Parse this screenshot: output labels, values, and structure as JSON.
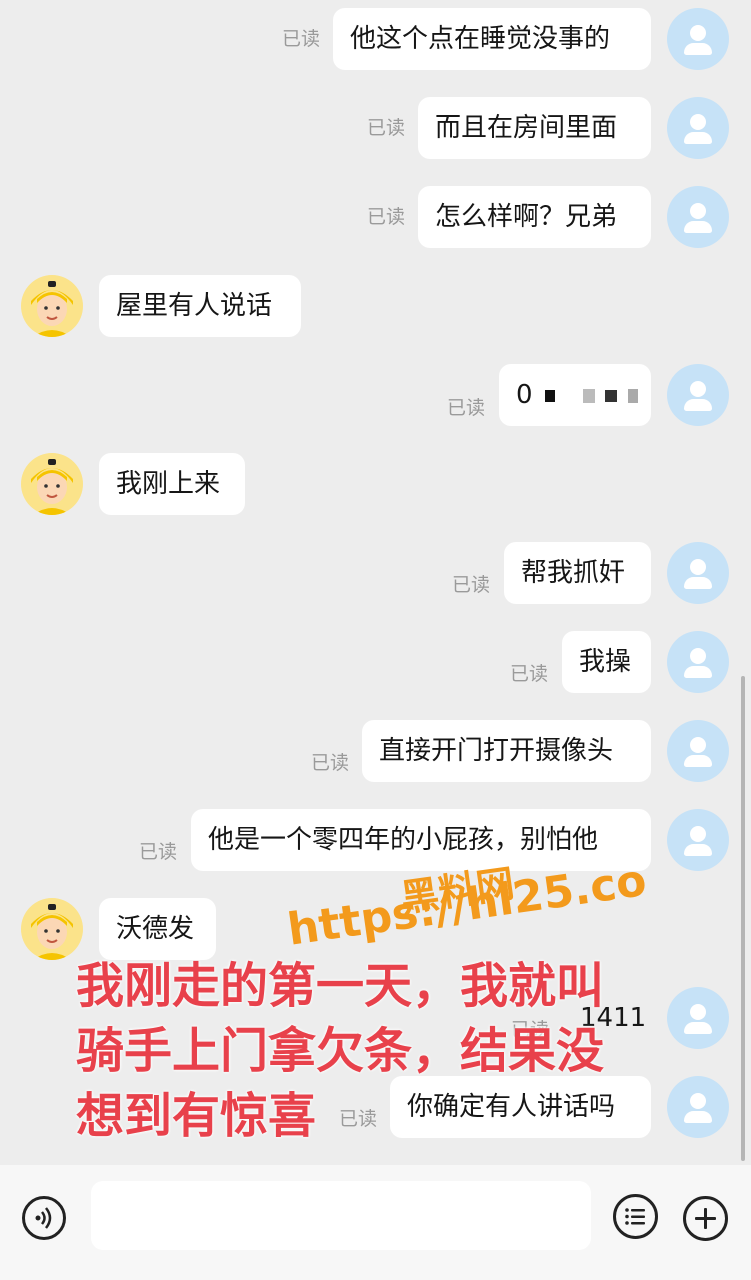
{
  "chat": {
    "read_label": "已读",
    "messages": [
      {
        "side": "me",
        "text": "他这个点在睡觉没事的",
        "read": true
      },
      {
        "side": "me",
        "text": "而且在房间里面",
        "read": true
      },
      {
        "side": "me",
        "text": "怎么样啊？兄弟",
        "read": true
      },
      {
        "side": "other",
        "text": "屋里有人说话"
      },
      {
        "side": "me",
        "text": "0",
        "read": true
      },
      {
        "side": "other",
        "text": "我刚上来"
      },
      {
        "side": "me",
        "text": "帮我抓奸",
        "read": true
      },
      {
        "side": "me",
        "text": "我操",
        "read": true
      },
      {
        "side": "me",
        "text": "直接开门打开摄像头",
        "read": true
      },
      {
        "side": "me",
        "text": "他是一个零四年的小屁孩，别怕他",
        "read": true
      },
      {
        "side": "other",
        "text": "沃德发"
      },
      {
        "side": "me",
        "text": "1411",
        "read": true
      },
      {
        "side": "me",
        "text": "你确定有人讲话吗",
        "read": true
      }
    ]
  },
  "input_bar": {
    "voice_icon": "voice-icon",
    "more_icon": "emoji-list-icon",
    "add_icon": "plus-icon"
  },
  "overlay": {
    "watermark_line1": "黑料网",
    "watermark_line2": "https://hl25.co",
    "caption_lines": [
      "我刚走的第一天，我就叫",
      "骑手上门拿欠条，结果没",
      "想到有惊喜"
    ]
  },
  "colors": {
    "background": "#ededed",
    "bubble": "#ffffff",
    "my_avatar": "#c6e2f7",
    "watermark": "#f39a1c",
    "caption": "#e8414b"
  }
}
